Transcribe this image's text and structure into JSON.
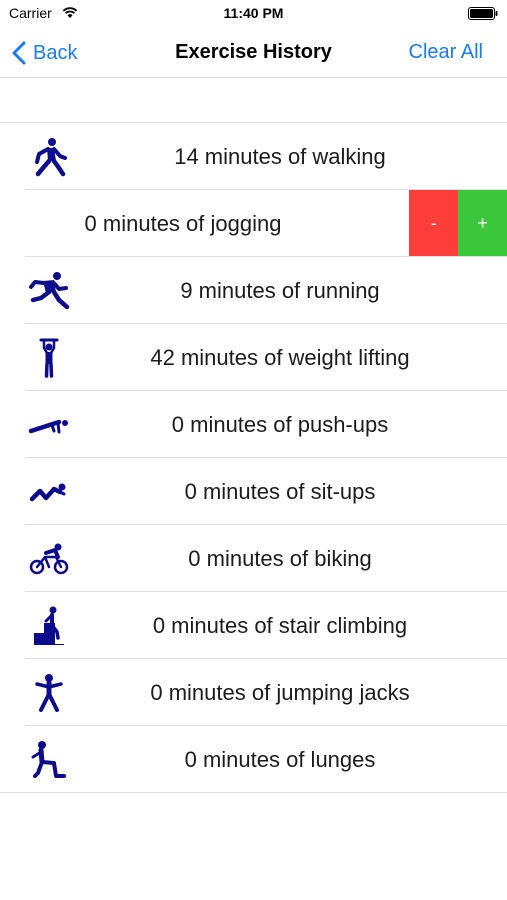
{
  "status_bar": {
    "carrier": "Carrier",
    "time": "11:40 PM"
  },
  "nav": {
    "back_label": "Back",
    "title": "Exercise History",
    "clear_label": "Clear All"
  },
  "colors": {
    "accent": "#1a7bf2",
    "icon": "#0c0c8c",
    "minus": "#fc3d39",
    "plus": "#3cc83c"
  },
  "exercises": [
    {
      "label": "14 minutes of walking",
      "icon": "walking-icon"
    },
    {
      "label": "0 minutes of jogging",
      "icon": "jogging-icon",
      "minus_label": "-",
      "plus_label": "+"
    },
    {
      "label": "9 minutes of running",
      "icon": "running-icon"
    },
    {
      "label": "42 minutes of weight lifting",
      "icon": "weight-lifting-icon"
    },
    {
      "label": "0 minutes of push-ups",
      "icon": "push-ups-icon"
    },
    {
      "label": "0 minutes of sit-ups",
      "icon": "sit-ups-icon"
    },
    {
      "label": "0 minutes of biking",
      "icon": "biking-icon"
    },
    {
      "label": "0 minutes of stair climbing",
      "icon": "stair-climbing-icon"
    },
    {
      "label": "0 minutes of jumping jacks",
      "icon": "jumping-jacks-icon"
    },
    {
      "label": "0 minutes of lunges",
      "icon": "lunges-icon"
    }
  ]
}
